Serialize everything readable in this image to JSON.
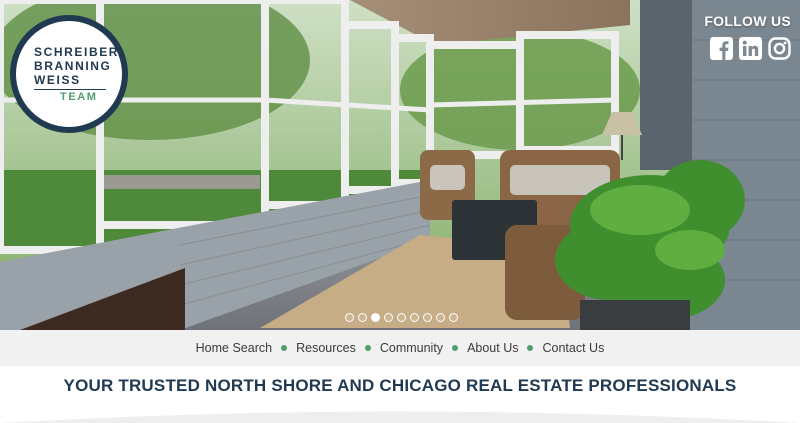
{
  "logo": {
    "line1": "SCHREIBER",
    "line2": "BRANNING",
    "line3": "WEISS",
    "team": "TEAM",
    "colors": {
      "navy": "#203a52",
      "green": "#4e9e6b"
    }
  },
  "social": {
    "label": "FOLLOW US",
    "icons": [
      "facebook-icon",
      "linkedin-icon",
      "instagram-icon"
    ]
  },
  "carousel": {
    "slide_count": 9,
    "active_index": 2
  },
  "nav": {
    "items": [
      {
        "label": "Home Search"
      },
      {
        "label": "Resources"
      },
      {
        "label": "Community"
      },
      {
        "label": "About Us"
      },
      {
        "label": "Contact Us"
      }
    ]
  },
  "tagline": "YOUR TRUSTED NORTH SHORE AND CHICAGO REAL ESTATE PROFESSIONALS"
}
